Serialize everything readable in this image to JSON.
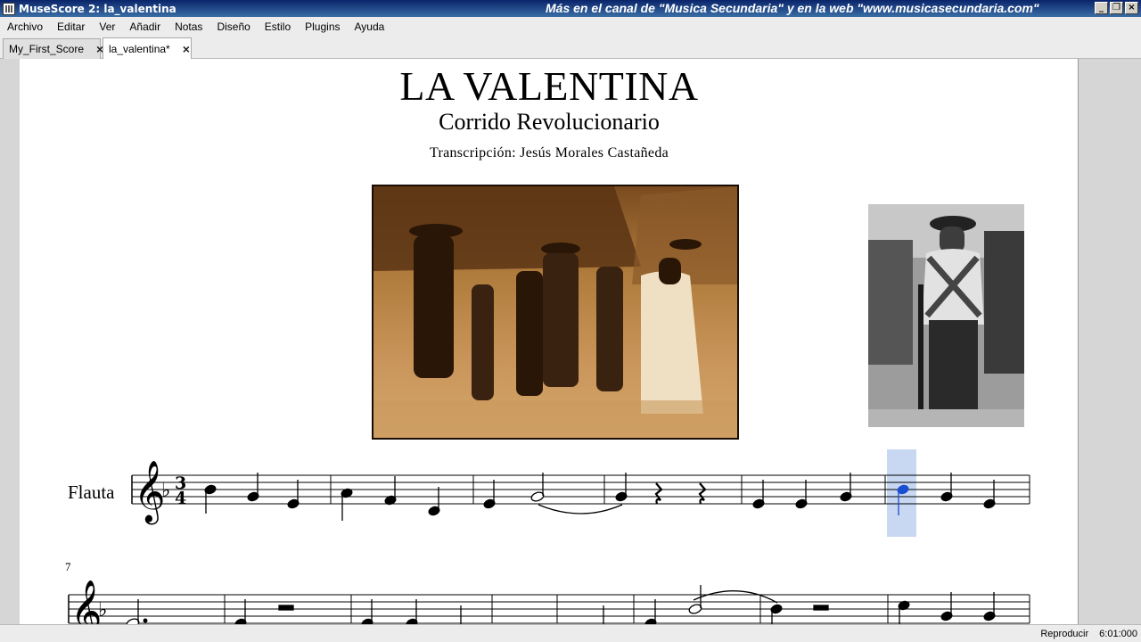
{
  "window": {
    "title": "MuseScore 2: la_valentina",
    "banner": "Más en el canal de \"Musica Secundaria\" y en la web \"www.musicasecundaria.com\"",
    "buttons": [
      "_",
      "❐",
      "×"
    ]
  },
  "menu": [
    "Archivo",
    "Editar",
    "Ver",
    "Añadir",
    "Notas",
    "Diseño",
    "Estilo",
    "Plugins",
    "Ayuda"
  ],
  "tabs": [
    {
      "label": "My_First_Score",
      "close": "×"
    },
    {
      "label": "la_valentina*",
      "close": "×"
    }
  ],
  "score": {
    "title": "LA VALENTINA",
    "subtitle": "Corrido Revolucionario",
    "composer": "Transcripción: Jesús Morales Castañeda",
    "instrument": "Flauta",
    "time_signature": {
      "numerator": "3",
      "denominator": "4"
    },
    "key": "F major (1 flat)",
    "second_system_measure_number": "7",
    "colors": {
      "selection": "#c8d7f2",
      "selected_note": "#1a4fd1",
      "ink": "#000000",
      "photo_sepia": "#c49552"
    }
  },
  "status": {
    "mode": "Reproducir",
    "position": "6:01:000"
  }
}
